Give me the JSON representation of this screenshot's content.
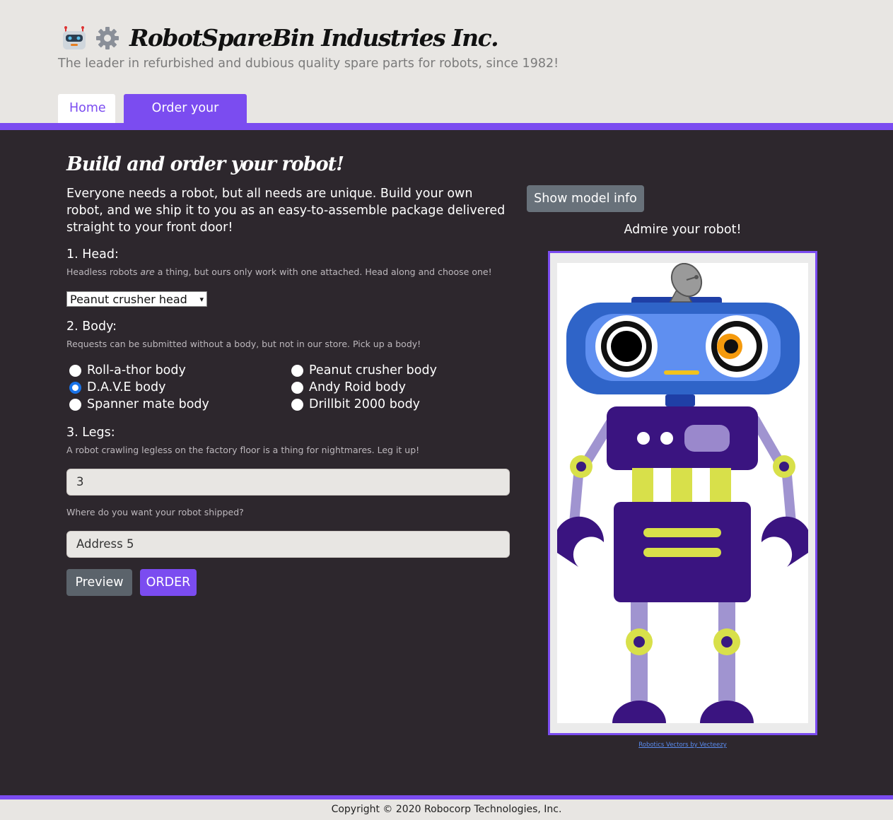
{
  "header": {
    "title": "RobotSpareBin Industries Inc.",
    "tagline": "The leader in refurbished and dubious quality spare parts for robots, since 1982!",
    "tabs": [
      {
        "label": "Home"
      },
      {
        "label": "Order your robot!"
      }
    ]
  },
  "main": {
    "title": "Build and order your robot!",
    "intro": "Everyone needs a robot, but all needs are unique. Build your own robot, and we ship it to you as an easy-to-assemble package delivered straight to your front door!",
    "head": {
      "label": "1. Head:",
      "hint_before": "Headless robots ",
      "hint_emph": "are",
      "hint_after": " a thing, but ours only work with one attached. Head along and choose one!",
      "selected": "Peanut crusher head"
    },
    "body": {
      "label": "2. Body:",
      "hint": "Requests can be submitted without a body, but not in our store. Pick up a body!",
      "options": [
        {
          "label": "Roll-a-thor body",
          "checked": false
        },
        {
          "label": "D.A.V.E body",
          "checked": true
        },
        {
          "label": "Spanner mate body",
          "checked": false
        },
        {
          "label": "Peanut crusher body",
          "checked": false
        },
        {
          "label": "Andy Roid body",
          "checked": false
        },
        {
          "label": "Drillbit 2000 body",
          "checked": false
        }
      ]
    },
    "legs": {
      "label": "3. Legs:",
      "hint": "A robot crawling legless on the factory floor is a thing for nightmares. Leg it up!",
      "value": "3"
    },
    "address": {
      "hint": "Where do you want your robot shipped?",
      "value": "Address 5"
    },
    "buttons": {
      "preview": "Preview",
      "order": "ORDER",
      "show_model": "Show model info"
    },
    "preview": {
      "caption": "Admire your robot!",
      "credit": "Robotics Vectors by Vecteezy"
    }
  },
  "footer": {
    "copyright": "Copyright © 2020 Robocorp Technologies, Inc."
  },
  "colors": {
    "accent": "#7b4cf0",
    "header_bg": "#e8e6e3",
    "main_bg": "#2d272d"
  }
}
